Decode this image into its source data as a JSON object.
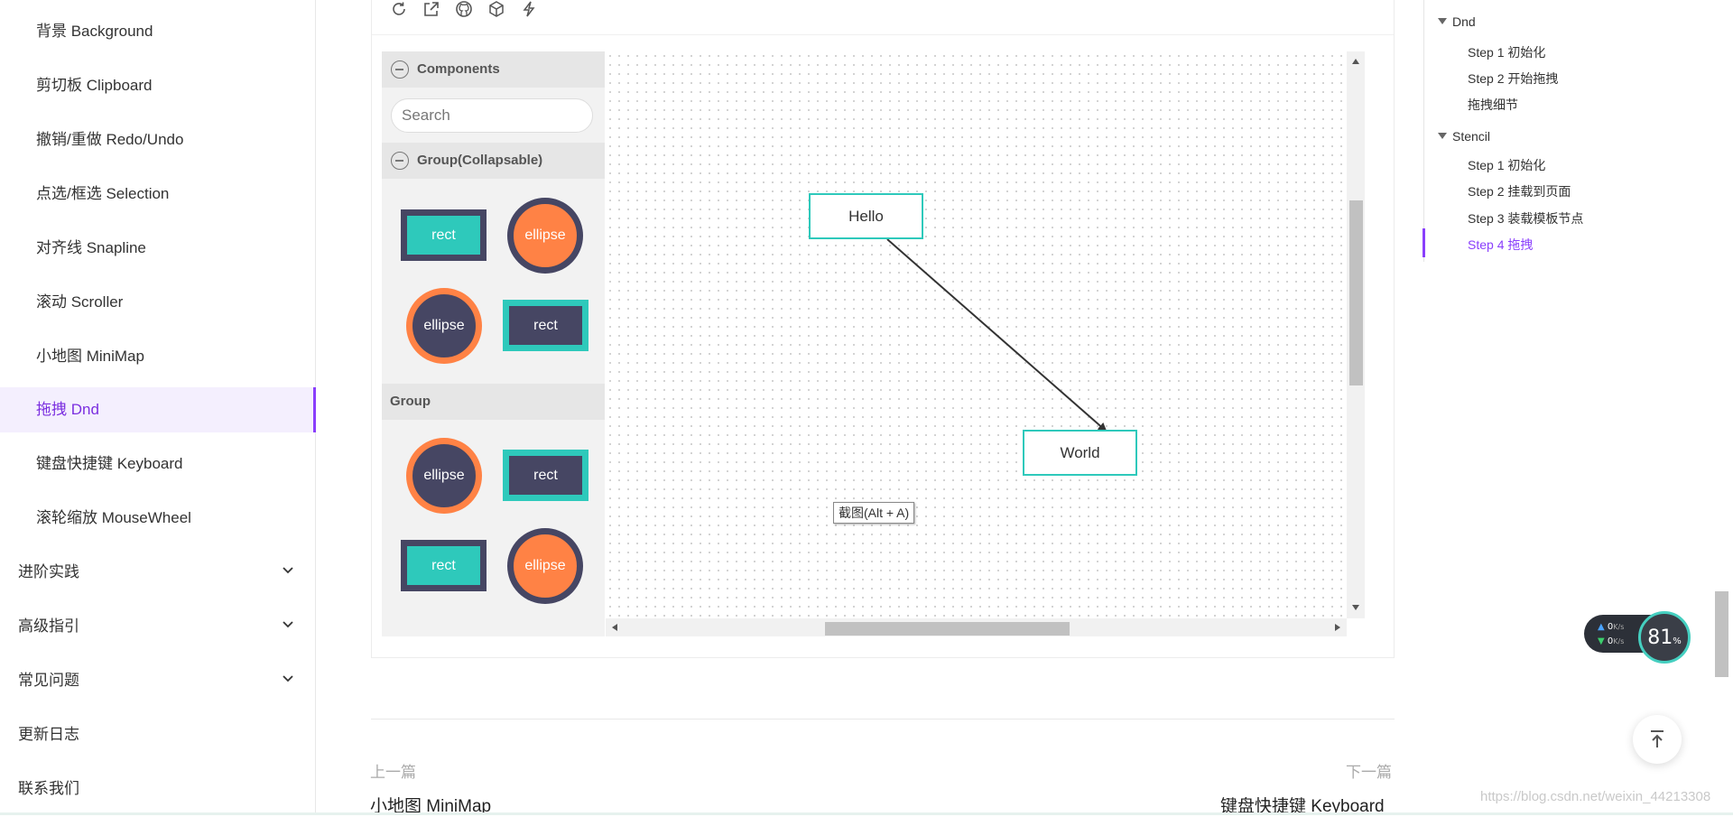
{
  "sidebar": {
    "items": [
      {
        "label": "背景 Background"
      },
      {
        "label": "剪切板 Clipboard"
      },
      {
        "label": "撤销/重做 Redo/Undo"
      },
      {
        "label": "点选/框选 Selection"
      },
      {
        "label": "对齐线 Snapline"
      },
      {
        "label": "滚动 Scroller"
      },
      {
        "label": "小地图 MiniMap"
      },
      {
        "label": "拖拽 Dnd"
      },
      {
        "label": "键盘快捷键 Keyboard"
      },
      {
        "label": "滚轮缩放 MouseWheel"
      }
    ],
    "sections": [
      {
        "label": "进阶实践"
      },
      {
        "label": "高级指引"
      },
      {
        "label": "常见问题"
      },
      {
        "label": "更新日志"
      },
      {
        "label": "联系我们"
      }
    ]
  },
  "toc": {
    "groups": [
      {
        "label": "Dnd",
        "items": [
          "Step 1 初始化",
          "Step 2 开始拖拽",
          "拖拽细节"
        ]
      },
      {
        "label": "Stencil",
        "items": [
          "Step 1 初始化",
          "Step 2 挂载到页面",
          "Step 3 装载模板节点",
          "Step 4 拖拽"
        ]
      }
    ]
  },
  "toolbar": {
    "icons": [
      "refresh-icon",
      "open-external-icon",
      "github-icon",
      "codesandbox-icon",
      "lightning-icon"
    ]
  },
  "stencil": {
    "title": "Components",
    "search_placeholder": "Search",
    "group1_title": "Group(Collapsable)",
    "group2_title": "Group",
    "labels": {
      "rect": "rect",
      "ellipse": "ellipse"
    }
  },
  "canvas": {
    "nodes": {
      "hello": "Hello",
      "world": "World"
    },
    "tooltip": "截图(Alt + A)"
  },
  "pager": {
    "prev_label": "上一篇",
    "prev_title": "小地图 MiniMap",
    "next_label": "下一篇",
    "next_title": "键盘快捷键 Keyboard"
  },
  "widget": {
    "up_speed": "0",
    "down_speed": "0",
    "speed_unit": "K/s",
    "cpu_value": "81",
    "cpu_unit": "%"
  },
  "watermark": "https://blog.csdn.net/weixin_44213308",
  "colors": {
    "accent": "#8a3ffc",
    "teal": "#2ec9bb",
    "navy": "#464663",
    "orange": "#ff8245"
  }
}
